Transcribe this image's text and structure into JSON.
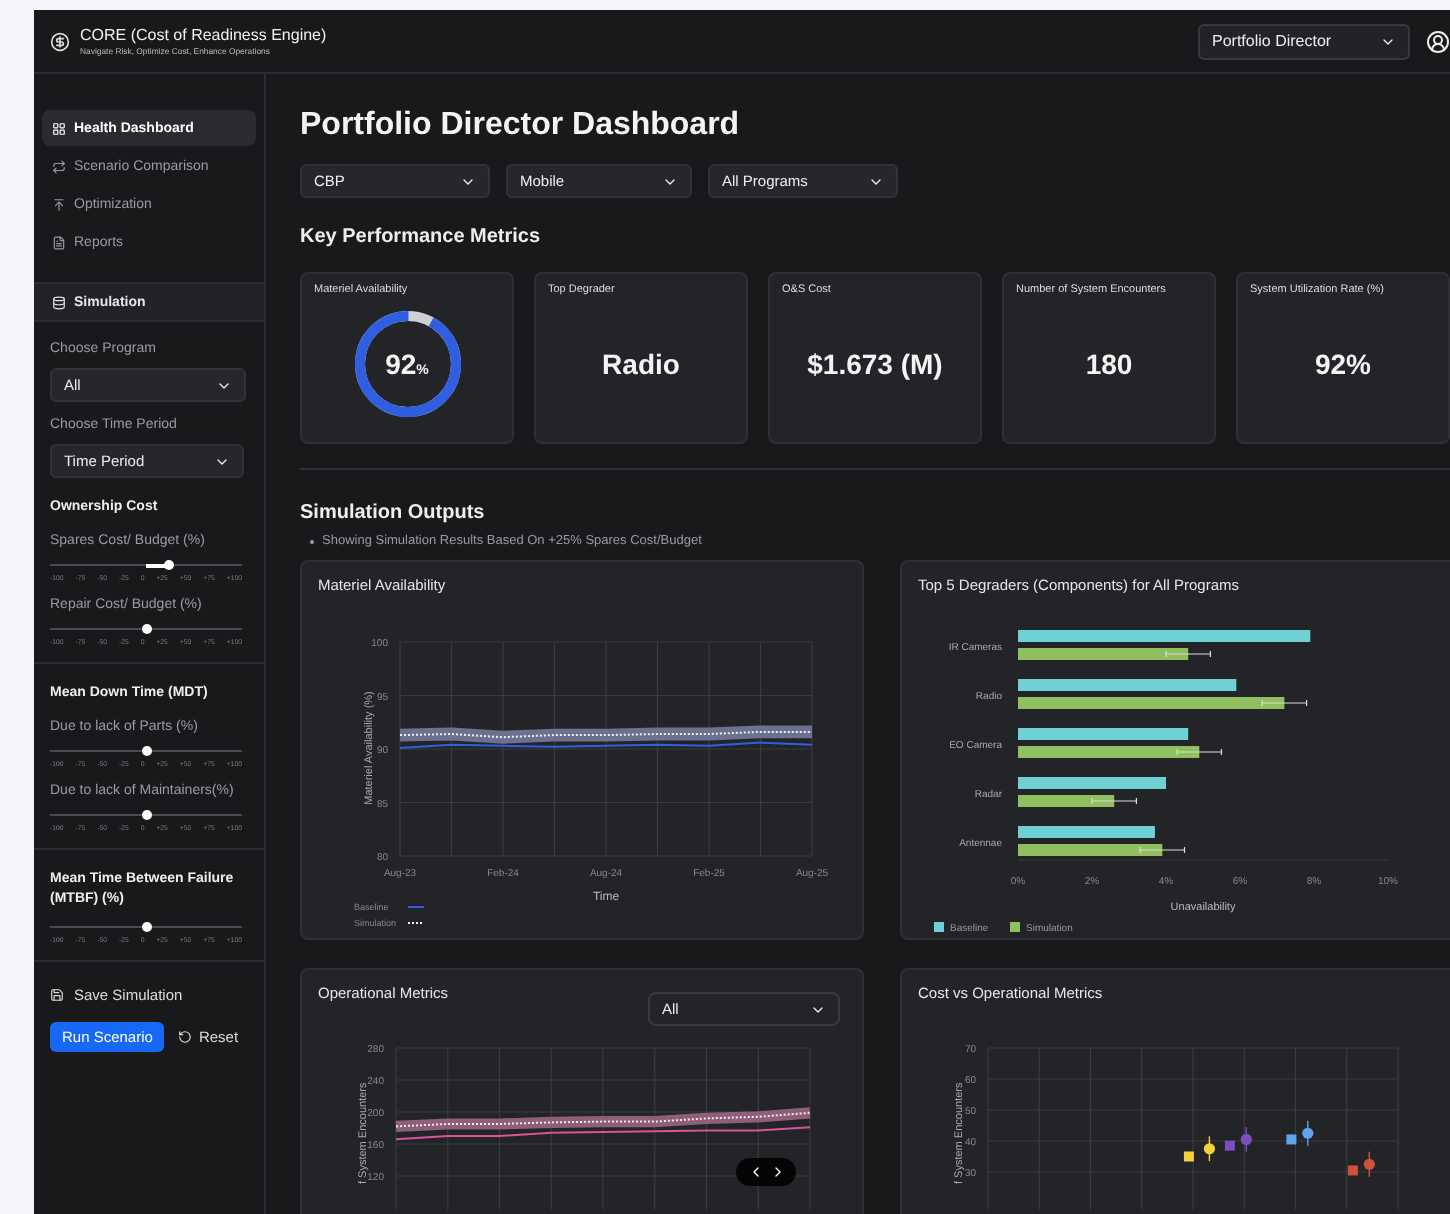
{
  "header": {
    "title": "CORE (Cost of Readiness Engine)",
    "subtitle": "Navigate Risk, Optimize Cost, Enhance Operations",
    "role": "Portfolio Director"
  },
  "nav": [
    {
      "label": "Health Dashboard",
      "kind": "grid",
      "selected": true
    },
    {
      "label": "Scenario Comparison",
      "kind": "compare",
      "selected": false
    },
    {
      "label": "Optimization",
      "kind": "optimize",
      "selected": false
    },
    {
      "label": "Reports",
      "kind": "report",
      "selected": false
    }
  ],
  "simulation": {
    "title": "Simulation",
    "program_label": "Choose Program",
    "program": "All",
    "period_label": "Choose Time Period",
    "period": "Time Period",
    "groups": [
      {
        "title": "Ownership Cost",
        "sliders": [
          {
            "label": "Spares Cost/ Budget (%)",
            "level": 0.62,
            "ticks": [
              "-100",
              "-75",
              "-50",
              "-25",
              "0",
              "+25",
              "+50",
              "+75",
              "+100"
            ]
          },
          {
            "label": "Repair Cost/ Budget (%)",
            "level": 0.5,
            "ticks": [
              "-100",
              "-75",
              "-50",
              "-25",
              "0",
              "+25",
              "+50",
              "+75",
              "+100"
            ]
          }
        ]
      },
      {
        "title": "Mean Down Time (MDT)",
        "sliders": [
          {
            "label": "Due to lack of Parts (%)",
            "level": 0.5,
            "ticks": [
              "-100",
              "-75",
              "-50",
              "-25",
              "0",
              "+25",
              "+50",
              "+75",
              "+100"
            ]
          },
          {
            "label": "Due to lack of Maintainers(%)",
            "level": 0.5,
            "ticks": [
              "-100",
              "-75",
              "-50",
              "-25",
              "0",
              "+25",
              "+50",
              "+75",
              "+100"
            ]
          }
        ]
      },
      {
        "title": "Mean Time Between Failure (MTBF) (%)",
        "sliders": [
          {
            "level": 0.5,
            "ticks": [
              "-100",
              "-75",
              "-50",
              "-25",
              "0",
              "+25",
              "+50",
              "+75",
              "+100"
            ]
          }
        ]
      }
    ],
    "save": "Save Simulation",
    "run": "Run Scenario",
    "reset": "Reset"
  },
  "main": {
    "title": "Portfolio Director Dashboard",
    "filters": [
      "CBP",
      "Mobile",
      "All Programs"
    ],
    "kpi_title": "Key Performance Metrics",
    "kpis": [
      {
        "label": "Materiel Availability",
        "kind": "donut",
        "value": "92",
        "unit": "%",
        "level": 0.92
      },
      {
        "label": "Top Degrader",
        "kind": "text",
        "value": "Radio"
      },
      {
        "label": "O&S Cost",
        "kind": "text",
        "value": "$1.673 (M)"
      },
      {
        "label": "Number of System Encounters",
        "kind": "text",
        "value": "180"
      },
      {
        "label": "System Utilization Rate (%)",
        "kind": "text",
        "value": "92%"
      }
    ],
    "sim_title": "Simulation Outputs",
    "note": "Showing Simulation Results Based On +25% Spares Cost/Budget",
    "availability": {
      "title": "Materiel Availability",
      "chart_data": {
        "type": "line",
        "grid": true,
        "legend": "bottom-left",
        "xlabel": "Time",
        "ylabel": "Materiel Availability (%)",
        "categories": [
          "Aug-23",
          null,
          "Feb-24",
          null,
          "Aug-24",
          null,
          "Feb-25",
          null,
          "Aug-25"
        ],
        "ylim": [
          80,
          100
        ],
        "yticks": [
          100,
          95,
          90,
          85,
          80
        ],
        "series": [
          {
            "name": "Baseline",
            "color": "#2f5fe0",
            "values": [
              90.1,
              90.4,
              90.3,
              90.2,
              90.3,
              90.4,
              90.3,
              90.6,
              90.4
            ]
          },
          {
            "name": "Simulation",
            "color": "#eef0fb",
            "line_style": "dotted",
            "values": [
              91.3,
              91.4,
              91.1,
              91.3,
              91.3,
              91.4,
              91.4,
              91.6,
              91.6
            ]
          }
        ]
      }
    },
    "degraders": {
      "title": "Top 5 Degraders (Components) for All Programs",
      "chart_data": {
        "type": "bar",
        "legend": "bottom-left",
        "orientation": "horizontal",
        "xlabel": "Unavailability",
        "categories": [
          "IR Cameras",
          "Radio",
          "EO Camera",
          "Radar",
          "Antennae"
        ],
        "xlim": [
          0,
          10
        ],
        "xticks": [
          {
            "value": 0,
            "label": "0%"
          },
          {
            "value": 2,
            "label": "2%"
          },
          {
            "value": 4,
            "label": "4%"
          },
          {
            "value": 6,
            "label": "6%"
          },
          {
            "value": 8,
            "label": "8%"
          },
          {
            "value": 10,
            "label": "10%"
          }
        ],
        "series": [
          {
            "name": "Baseline",
            "color": "#6fd0d6",
            "values": [
              7.9,
              5.9,
              4.6,
              4.0,
              3.7
            ]
          },
          {
            "name": "Simulation",
            "color": "#8fbf5f",
            "values": [
              4.6,
              7.2,
              4.9,
              2.6,
              3.9
            ],
            "errors": [
              0.6,
              0.6,
              0.6,
              0.6,
              0.6
            ]
          }
        ]
      }
    },
    "operational": {
      "title": "Operational Metrics",
      "filter": "All",
      "chart_data": {
        "type": "line",
        "grid": true,
        "ylabel": "f System Encounters",
        "categories": [
          null,
          null,
          null,
          null,
          null,
          null,
          null,
          null,
          null
        ],
        "ylim": [
          40,
          280
        ],
        "yticks": [
          280,
          240,
          200,
          160,
          120
        ],
        "series": [
          {
            "color": "#d9539a",
            "values": [
              166,
              170,
              170,
              174,
              175,
              176,
              177,
              177,
              181
            ]
          },
          {
            "color": "#fbe6f1",
            "line_style": "dotted",
            "values": [
              182,
              185,
              185,
              187,
              188,
              188,
              192,
              194,
              199
            ]
          }
        ]
      }
    },
    "cost": {
      "title": "Cost vs Operational Metrics",
      "y_title": "f System Encounters",
      "y_labels": [
        "70",
        "60",
        "50",
        "40",
        "30"
      ]
    }
  }
}
